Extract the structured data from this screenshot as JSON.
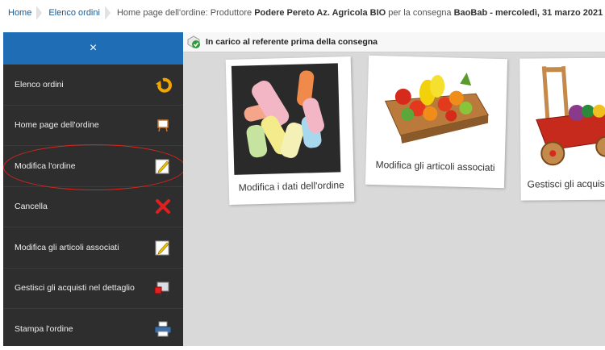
{
  "breadcrumb": {
    "home": "Home",
    "orders": "Elenco ordini",
    "current_prefix": "Home page dell'ordine: Produttore ",
    "producer": "Podere Pereto Az. Agricola BIO",
    "current_mid": " per la consegna ",
    "delivery": "BaoBab - mercoledì, 31 marzo 2021"
  },
  "sidebar": {
    "close_label": "×",
    "items": [
      {
        "label": "Elenco ordini",
        "icon": "back-arrow-icon"
      },
      {
        "label": "Home page dell'ordine",
        "icon": "easel-icon"
      },
      {
        "label": "Modifica l'ordine",
        "icon": "edit-pencil-icon"
      },
      {
        "label": "Cancella",
        "icon": "delete-x-icon"
      },
      {
        "label": "Modifica gli articoli associati",
        "icon": "edit-pencil-icon"
      },
      {
        "label": "Gestisci gli acquisti nel dettaglio",
        "icon": "cart-icon"
      },
      {
        "label": "Stampa l'ordine",
        "icon": "printer-icon"
      }
    ]
  },
  "status": {
    "text": "In carico al referente prima della consegna"
  },
  "cards": [
    {
      "label": "Modifica i dati dell'ordine",
      "image": "chalk-sticks"
    },
    {
      "label": "Modifica gli articoli associati",
      "image": "fruit-crate"
    },
    {
      "label": "Gestisci gli acquisti nel dettaglio",
      "image": "wooden-cart"
    }
  ],
  "colors": {
    "sidebar_bg": "#2e2e2e",
    "sidebar_header": "#1f6db4",
    "main_bg": "#d9d9d9",
    "link": "#1a5a94",
    "highlight": "#d9261c"
  }
}
